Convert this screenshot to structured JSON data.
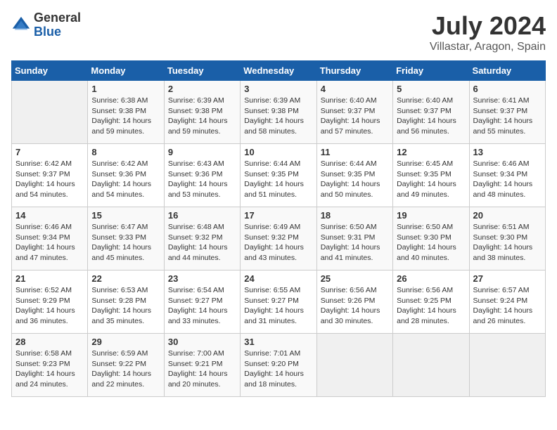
{
  "logo": {
    "general": "General",
    "blue": "Blue"
  },
  "title": "July 2024",
  "location": "Villastar, Aragon, Spain",
  "days_of_week": [
    "Sunday",
    "Monday",
    "Tuesday",
    "Wednesday",
    "Thursday",
    "Friday",
    "Saturday"
  ],
  "weeks": [
    [
      {
        "day": "",
        "sunrise": "",
        "sunset": "",
        "daylight": ""
      },
      {
        "day": "1",
        "sunrise": "Sunrise: 6:38 AM",
        "sunset": "Sunset: 9:38 PM",
        "daylight": "Daylight: 14 hours and 59 minutes."
      },
      {
        "day": "2",
        "sunrise": "Sunrise: 6:39 AM",
        "sunset": "Sunset: 9:38 PM",
        "daylight": "Daylight: 14 hours and 59 minutes."
      },
      {
        "day": "3",
        "sunrise": "Sunrise: 6:39 AM",
        "sunset": "Sunset: 9:38 PM",
        "daylight": "Daylight: 14 hours and 58 minutes."
      },
      {
        "day": "4",
        "sunrise": "Sunrise: 6:40 AM",
        "sunset": "Sunset: 9:37 PM",
        "daylight": "Daylight: 14 hours and 57 minutes."
      },
      {
        "day": "5",
        "sunrise": "Sunrise: 6:40 AM",
        "sunset": "Sunset: 9:37 PM",
        "daylight": "Daylight: 14 hours and 56 minutes."
      },
      {
        "day": "6",
        "sunrise": "Sunrise: 6:41 AM",
        "sunset": "Sunset: 9:37 PM",
        "daylight": "Daylight: 14 hours and 55 minutes."
      }
    ],
    [
      {
        "day": "7",
        "sunrise": "Sunrise: 6:42 AM",
        "sunset": "Sunset: 9:37 PM",
        "daylight": "Daylight: 14 hours and 54 minutes."
      },
      {
        "day": "8",
        "sunrise": "Sunrise: 6:42 AM",
        "sunset": "Sunset: 9:36 PM",
        "daylight": "Daylight: 14 hours and 54 minutes."
      },
      {
        "day": "9",
        "sunrise": "Sunrise: 6:43 AM",
        "sunset": "Sunset: 9:36 PM",
        "daylight": "Daylight: 14 hours and 53 minutes."
      },
      {
        "day": "10",
        "sunrise": "Sunrise: 6:44 AM",
        "sunset": "Sunset: 9:35 PM",
        "daylight": "Daylight: 14 hours and 51 minutes."
      },
      {
        "day": "11",
        "sunrise": "Sunrise: 6:44 AM",
        "sunset": "Sunset: 9:35 PM",
        "daylight": "Daylight: 14 hours and 50 minutes."
      },
      {
        "day": "12",
        "sunrise": "Sunrise: 6:45 AM",
        "sunset": "Sunset: 9:35 PM",
        "daylight": "Daylight: 14 hours and 49 minutes."
      },
      {
        "day": "13",
        "sunrise": "Sunrise: 6:46 AM",
        "sunset": "Sunset: 9:34 PM",
        "daylight": "Daylight: 14 hours and 48 minutes."
      }
    ],
    [
      {
        "day": "14",
        "sunrise": "Sunrise: 6:46 AM",
        "sunset": "Sunset: 9:34 PM",
        "daylight": "Daylight: 14 hours and 47 minutes."
      },
      {
        "day": "15",
        "sunrise": "Sunrise: 6:47 AM",
        "sunset": "Sunset: 9:33 PM",
        "daylight": "Daylight: 14 hours and 45 minutes."
      },
      {
        "day": "16",
        "sunrise": "Sunrise: 6:48 AM",
        "sunset": "Sunset: 9:32 PM",
        "daylight": "Daylight: 14 hours and 44 minutes."
      },
      {
        "day": "17",
        "sunrise": "Sunrise: 6:49 AM",
        "sunset": "Sunset: 9:32 PM",
        "daylight": "Daylight: 14 hours and 43 minutes."
      },
      {
        "day": "18",
        "sunrise": "Sunrise: 6:50 AM",
        "sunset": "Sunset: 9:31 PM",
        "daylight": "Daylight: 14 hours and 41 minutes."
      },
      {
        "day": "19",
        "sunrise": "Sunrise: 6:50 AM",
        "sunset": "Sunset: 9:30 PM",
        "daylight": "Daylight: 14 hours and 40 minutes."
      },
      {
        "day": "20",
        "sunrise": "Sunrise: 6:51 AM",
        "sunset": "Sunset: 9:30 PM",
        "daylight": "Daylight: 14 hours and 38 minutes."
      }
    ],
    [
      {
        "day": "21",
        "sunrise": "Sunrise: 6:52 AM",
        "sunset": "Sunset: 9:29 PM",
        "daylight": "Daylight: 14 hours and 36 minutes."
      },
      {
        "day": "22",
        "sunrise": "Sunrise: 6:53 AM",
        "sunset": "Sunset: 9:28 PM",
        "daylight": "Daylight: 14 hours and 35 minutes."
      },
      {
        "day": "23",
        "sunrise": "Sunrise: 6:54 AM",
        "sunset": "Sunset: 9:27 PM",
        "daylight": "Daylight: 14 hours and 33 minutes."
      },
      {
        "day": "24",
        "sunrise": "Sunrise: 6:55 AM",
        "sunset": "Sunset: 9:27 PM",
        "daylight": "Daylight: 14 hours and 31 minutes."
      },
      {
        "day": "25",
        "sunrise": "Sunrise: 6:56 AM",
        "sunset": "Sunset: 9:26 PM",
        "daylight": "Daylight: 14 hours and 30 minutes."
      },
      {
        "day": "26",
        "sunrise": "Sunrise: 6:56 AM",
        "sunset": "Sunset: 9:25 PM",
        "daylight": "Daylight: 14 hours and 28 minutes."
      },
      {
        "day": "27",
        "sunrise": "Sunrise: 6:57 AM",
        "sunset": "Sunset: 9:24 PM",
        "daylight": "Daylight: 14 hours and 26 minutes."
      }
    ],
    [
      {
        "day": "28",
        "sunrise": "Sunrise: 6:58 AM",
        "sunset": "Sunset: 9:23 PM",
        "daylight": "Daylight: 14 hours and 24 minutes."
      },
      {
        "day": "29",
        "sunrise": "Sunrise: 6:59 AM",
        "sunset": "Sunset: 9:22 PM",
        "daylight": "Daylight: 14 hours and 22 minutes."
      },
      {
        "day": "30",
        "sunrise": "Sunrise: 7:00 AM",
        "sunset": "Sunset: 9:21 PM",
        "daylight": "Daylight: 14 hours and 20 minutes."
      },
      {
        "day": "31",
        "sunrise": "Sunrise: 7:01 AM",
        "sunset": "Sunset: 9:20 PM",
        "daylight": "Daylight: 14 hours and 18 minutes."
      },
      {
        "day": "",
        "sunrise": "",
        "sunset": "",
        "daylight": ""
      },
      {
        "day": "",
        "sunrise": "",
        "sunset": "",
        "daylight": ""
      },
      {
        "day": "",
        "sunrise": "",
        "sunset": "",
        "daylight": ""
      }
    ]
  ]
}
